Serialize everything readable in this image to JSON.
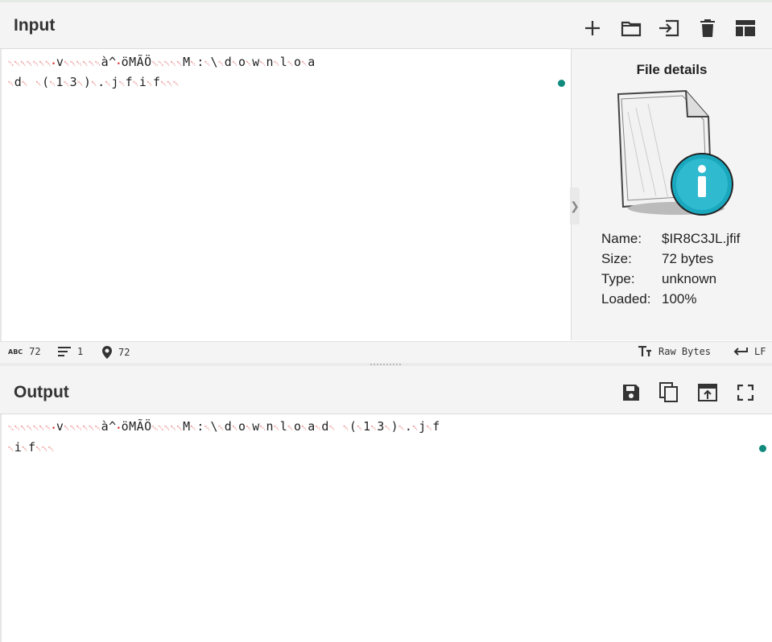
{
  "input": {
    "title": "Input",
    "text_line1": "␂␀␀␀␀␀␀•v␀␀␀␀␀␀à^•öMÃÖ␁␂␀␀␀M␀:␀\\␀d␀o␀w␀n␀l␀o␀a",
    "text_line2": "␀d␀ ␀(␀1␀3␀)␀.␀j␀f␀i␀f␀␀␀"
  },
  "file_details": {
    "title": "File details",
    "name_label": "Name:",
    "name_value": "$IR8C3JL.jfif",
    "size_label": "Size:",
    "size_value": "72 bytes",
    "type_label": "Type:",
    "type_value": "unknown",
    "loaded_label": "Loaded:",
    "loaded_value": "100%"
  },
  "status": {
    "abc_icon": "ABC",
    "length": "72",
    "lines": "1",
    "position": "72",
    "encoding": "Raw Bytes",
    "eol": "LF"
  },
  "output": {
    "title": "Output",
    "text_line1": "␂␀␀␀␀␀␀•v␀␀␀␀␀␀à^•öMÃÖ␁␂␀␀␀M␀:␀\\␀d␀o␀w␀n␀l␀o␀a␀d␀ ␀(␀1␀3␀)␀.␀j␀f",
    "text_line2": "␀i␀f␀␀␀"
  },
  "icons": {
    "add": "plus-icon",
    "open_folder": "folder-icon",
    "import": "import-icon",
    "delete": "trash-icon",
    "layout": "layout-icon",
    "save": "save-icon",
    "copy": "copy-icon",
    "replace_input": "upload-icon",
    "maximise": "fullscreen-icon",
    "collapse_arrow": "❯"
  },
  "colors": {
    "accent": "#118a7e",
    "control_char": "#d44",
    "header_bg": "#f4f4f4"
  }
}
